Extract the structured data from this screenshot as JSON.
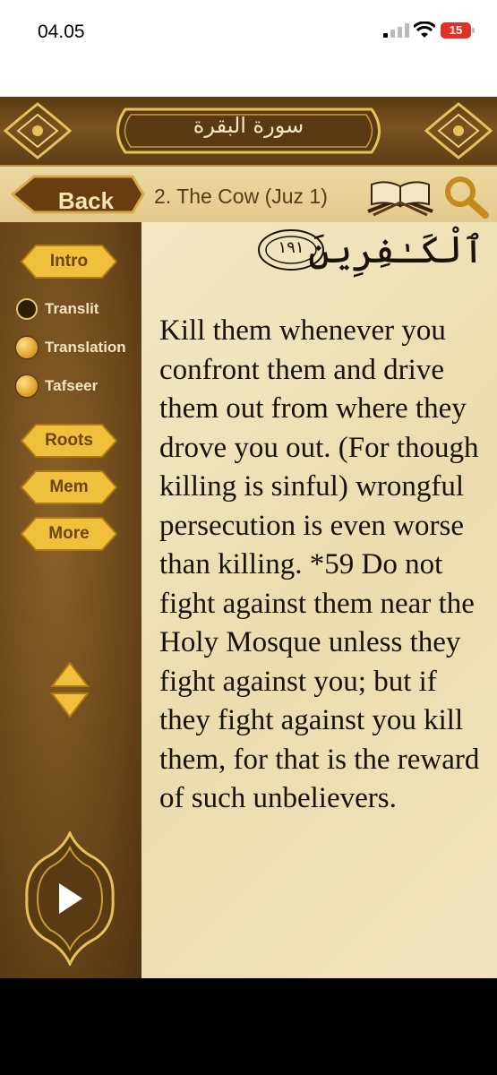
{
  "status_bar": {
    "time": "04.05",
    "battery": "15"
  },
  "header": {
    "title": "سورة البقرة"
  },
  "navbar": {
    "back_label": "Back",
    "surah": "2. The Cow (Juz 1)"
  },
  "sidebar": {
    "intro_label": "Intro",
    "options": [
      {
        "label": "Translit",
        "selected": false
      },
      {
        "label": "Translation",
        "selected": true
      },
      {
        "label": "Tafseer",
        "selected": true
      }
    ],
    "roots_label": "Roots",
    "mem_label": "Mem",
    "more_label": "More"
  },
  "content": {
    "arabic_word": "ٱلْكَـٰفِرِينَ",
    "ayah_number": "١٩١",
    "translation": "Kill them whenever you confront them and drive them out from where they drove you out. (For though killing is sinful) wrongful persecution is even worse than killing. *59 Do not fight against them near the Holy Mosque unless they fight against you; but if they fight against you kill them, for that is the reward of such unbelievers."
  },
  "colors": {
    "accent_gold": "#e8b83a",
    "frame_brown": "#6b4a1f",
    "parchment": "#f1e3bc",
    "battery_red": "#e0302a"
  }
}
